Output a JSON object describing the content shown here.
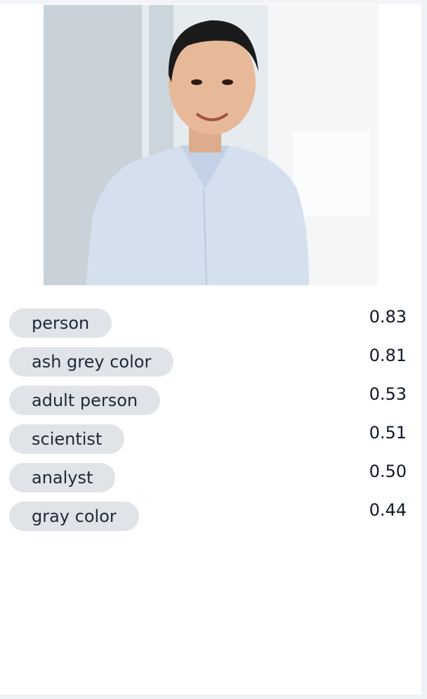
{
  "photo": {
    "subject_icon": "person-portrait-photo",
    "colors": {
      "background": "#dfe6ea",
      "shirt": "#d9e3f1",
      "skin": "#e7b999",
      "hair": "#1b1b1b"
    }
  },
  "tags": [
    {
      "label": "person",
      "score": "0.83"
    },
    {
      "label": "ash grey color",
      "score": "0.81"
    },
    {
      "label": "adult person",
      "score": "0.53"
    },
    {
      "label": "scientist",
      "score": "0.51"
    },
    {
      "label": "analyst",
      "score": "0.50"
    },
    {
      "label": "gray color",
      "score": "0.44"
    }
  ],
  "colors": {
    "pill_background": "#e0e3e7",
    "text": "#1f2937"
  }
}
